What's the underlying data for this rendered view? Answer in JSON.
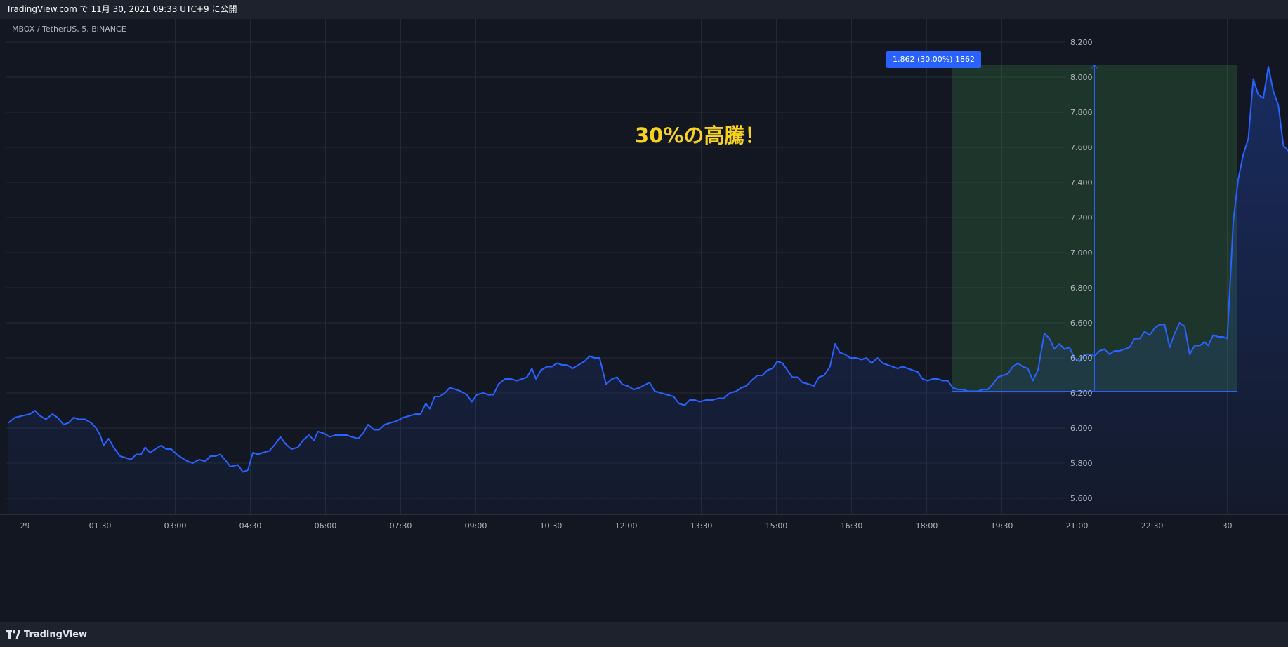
{
  "header": {
    "published_text": "TradingView.com で 11月 30, 2021 09:33 UTC+9 に公開"
  },
  "symbol": {
    "label": "MBOX / TetherUS, 5, BINANCE"
  },
  "annotation": {
    "text": "30%の高騰！"
  },
  "measure": {
    "label": "1.862 (30.00%) 1862"
  },
  "footer": {
    "logo_text": "TradingView"
  },
  "colors": {
    "background": "#131722",
    "line": "#2962ff",
    "area_fill": "#2962ff",
    "measure_fill": "#4caf50",
    "annotation": "#f7d21e",
    "grid": "#242832"
  },
  "chart_data": {
    "type": "area",
    "ylim": [
      5.5,
      8.3
    ],
    "y_ticks": [
      "8.200",
      "8.000",
      "7.800",
      "7.600",
      "7.400",
      "7.200",
      "7.000",
      "6.800",
      "6.600",
      "6.400",
      "6.200",
      "6.000",
      "5.800",
      "5.600"
    ],
    "x_ticks": [
      "29",
      "01:30",
      "03:00",
      "04:30",
      "06:00",
      "07:30",
      "09:00",
      "10:30",
      "12:00",
      "13:30",
      "15:00",
      "16:30",
      "18:00",
      "19:30",
      "21:00",
      "22:30",
      "30"
    ],
    "x_tick_hours": [
      0,
      1.5,
      3,
      4.5,
      6,
      7.5,
      9,
      10.5,
      12,
      13.5,
      15,
      16.5,
      18,
      19.5,
      21,
      22.5,
      24
    ],
    "series": [
      {
        "points": [
          [
            -0.33,
            6.03
          ],
          [
            -0.2,
            6.06
          ],
          [
            -0.05,
            6.07
          ],
          [
            0.1,
            6.08
          ],
          [
            0.2,
            6.1
          ],
          [
            0.3,
            6.07
          ],
          [
            0.42,
            6.05
          ],
          [
            0.55,
            6.08
          ],
          [
            0.65,
            6.06
          ],
          [
            0.77,
            6.02
          ],
          [
            0.87,
            6.03
          ],
          [
            0.97,
            6.06
          ],
          [
            1.08,
            6.05
          ],
          [
            1.2,
            6.05
          ],
          [
            1.32,
            6.03
          ],
          [
            1.42,
            6.0
          ],
          [
            1.5,
            5.96
          ],
          [
            1.57,
            5.9
          ],
          [
            1.67,
            5.94
          ],
          [
            1.77,
            5.89
          ],
          [
            1.9,
            5.84
          ],
          [
            2.02,
            5.83
          ],
          [
            2.12,
            5.82
          ],
          [
            2.22,
            5.85
          ],
          [
            2.32,
            5.85
          ],
          [
            2.4,
            5.89
          ],
          [
            2.5,
            5.86
          ],
          [
            2.6,
            5.88
          ],
          [
            2.72,
            5.9
          ],
          [
            2.82,
            5.88
          ],
          [
            2.92,
            5.88
          ],
          [
            3.03,
            5.85
          ],
          [
            3.13,
            5.83
          ],
          [
            3.25,
            5.81
          ],
          [
            3.35,
            5.8
          ],
          [
            3.48,
            5.82
          ],
          [
            3.6,
            5.81
          ],
          [
            3.7,
            5.84
          ],
          [
            3.8,
            5.84
          ],
          [
            3.9,
            5.85
          ],
          [
            4.02,
            5.81
          ],
          [
            4.1,
            5.78
          ],
          [
            4.25,
            5.79
          ],
          [
            4.35,
            5.75
          ],
          [
            4.45,
            5.76
          ],
          [
            4.55,
            5.86
          ],
          [
            4.65,
            5.85
          ],
          [
            4.75,
            5.86
          ],
          [
            4.88,
            5.87
          ],
          [
            5.0,
            5.91
          ],
          [
            5.1,
            5.95
          ],
          [
            5.2,
            5.91
          ],
          [
            5.32,
            5.88
          ],
          [
            5.45,
            5.89
          ],
          [
            5.55,
            5.93
          ],
          [
            5.67,
            5.96
          ],
          [
            5.77,
            5.93
          ],
          [
            5.85,
            5.98
          ],
          [
            5.97,
            5.97
          ],
          [
            6.08,
            5.95
          ],
          [
            6.2,
            5.96
          ],
          [
            6.3,
            5.96
          ],
          [
            6.42,
            5.96
          ],
          [
            6.52,
            5.95
          ],
          [
            6.65,
            5.94
          ],
          [
            6.75,
            5.97
          ],
          [
            6.85,
            6.02
          ],
          [
            6.97,
            5.99
          ],
          [
            7.07,
            5.99
          ],
          [
            7.18,
            6.02
          ],
          [
            7.3,
            6.03
          ],
          [
            7.42,
            6.04
          ],
          [
            7.55,
            6.06
          ],
          [
            7.68,
            6.07
          ],
          [
            7.8,
            6.08
          ],
          [
            7.9,
            6.08
          ],
          [
            8.0,
            6.14
          ],
          [
            8.08,
            6.11
          ],
          [
            8.18,
            6.18
          ],
          [
            8.28,
            6.18
          ],
          [
            8.38,
            6.2
          ],
          [
            8.48,
            6.23
          ],
          [
            8.6,
            6.22
          ],
          [
            8.7,
            6.21
          ],
          [
            8.82,
            6.19
          ],
          [
            8.92,
            6.15
          ],
          [
            9.02,
            6.19
          ],
          [
            9.15,
            6.2
          ],
          [
            9.25,
            6.19
          ],
          [
            9.35,
            6.19
          ],
          [
            9.45,
            6.25
          ],
          [
            9.58,
            6.28
          ],
          [
            9.7,
            6.28
          ],
          [
            9.82,
            6.27
          ],
          [
            9.92,
            6.28
          ],
          [
            10.02,
            6.29
          ],
          [
            10.12,
            6.34
          ],
          [
            10.2,
            6.28
          ],
          [
            10.3,
            6.33
          ],
          [
            10.42,
            6.35
          ],
          [
            10.52,
            6.35
          ],
          [
            10.62,
            6.37
          ],
          [
            10.72,
            6.36
          ],
          [
            10.82,
            6.36
          ],
          [
            10.93,
            6.34
          ],
          [
            11.05,
            6.36
          ],
          [
            11.17,
            6.38
          ],
          [
            11.27,
            6.41
          ],
          [
            11.37,
            6.4
          ],
          [
            11.47,
            6.4
          ],
          [
            11.6,
            6.25
          ],
          [
            11.72,
            6.28
          ],
          [
            11.82,
            6.29
          ],
          [
            11.92,
            6.25
          ],
          [
            12.03,
            6.24
          ],
          [
            12.15,
            6.22
          ],
          [
            12.27,
            6.23
          ],
          [
            12.4,
            6.25
          ],
          [
            12.47,
            6.26
          ],
          [
            12.57,
            6.21
          ],
          [
            12.7,
            6.2
          ],
          [
            12.82,
            6.19
          ],
          [
            12.95,
            6.18
          ],
          [
            13.05,
            6.14
          ],
          [
            13.17,
            6.13
          ],
          [
            13.27,
            6.16
          ],
          [
            13.37,
            6.16
          ],
          [
            13.47,
            6.15
          ],
          [
            13.6,
            6.16
          ],
          [
            13.72,
            6.16
          ],
          [
            13.85,
            6.17
          ],
          [
            13.95,
            6.17
          ],
          [
            14.07,
            6.2
          ],
          [
            14.2,
            6.21
          ],
          [
            14.3,
            6.23
          ],
          [
            14.4,
            6.24
          ],
          [
            14.5,
            6.27
          ],
          [
            14.62,
            6.3
          ],
          [
            14.72,
            6.3
          ],
          [
            14.82,
            6.33
          ],
          [
            14.92,
            6.34
          ],
          [
            15.02,
            6.38
          ],
          [
            15.12,
            6.37
          ],
          [
            15.22,
            6.33
          ],
          [
            15.32,
            6.29
          ],
          [
            15.42,
            6.29
          ],
          [
            15.52,
            6.26
          ],
          [
            15.65,
            6.25
          ],
          [
            15.75,
            6.24
          ],
          [
            15.85,
            6.29
          ],
          [
            15.95,
            6.3
          ],
          [
            16.07,
            6.35
          ],
          [
            16.17,
            6.48
          ],
          [
            16.27,
            6.43
          ],
          [
            16.37,
            6.42
          ],
          [
            16.47,
            6.4
          ],
          [
            16.6,
            6.4
          ],
          [
            16.7,
            6.39
          ],
          [
            16.8,
            6.4
          ],
          [
            16.9,
            6.37
          ],
          [
            17.02,
            6.4
          ],
          [
            17.12,
            6.37
          ],
          [
            17.22,
            6.36
          ],
          [
            17.32,
            6.35
          ],
          [
            17.42,
            6.34
          ],
          [
            17.52,
            6.35
          ],
          [
            17.62,
            6.34
          ],
          [
            17.72,
            6.33
          ],
          [
            17.82,
            6.32
          ],
          [
            17.92,
            6.28
          ],
          [
            18.02,
            6.27
          ],
          [
            18.12,
            6.28
          ],
          [
            18.22,
            6.28
          ],
          [
            18.32,
            6.27
          ],
          [
            18.42,
            6.27
          ],
          [
            18.52,
            6.23
          ],
          [
            18.62,
            6.22
          ],
          [
            18.72,
            6.22
          ],
          [
            18.82,
            6.21
          ],
          [
            18.92,
            6.21
          ],
          [
            19.02,
            6.21
          ],
          [
            19.12,
            6.22
          ],
          [
            19.22,
            6.22
          ],
          [
            19.32,
            6.25
          ],
          [
            19.42,
            6.29
          ],
          [
            19.52,
            6.3
          ],
          [
            19.62,
            6.31
          ],
          [
            19.72,
            6.35
          ],
          [
            19.82,
            6.37
          ],
          [
            19.92,
            6.35
          ],
          [
            20.02,
            6.34
          ],
          [
            20.12,
            6.27
          ],
          [
            20.22,
            6.33
          ],
          [
            20.35,
            6.54
          ],
          [
            20.45,
            6.51
          ],
          [
            20.55,
            6.45
          ],
          [
            20.65,
            6.48
          ],
          [
            20.75,
            6.45
          ],
          [
            20.85,
            6.46
          ],
          [
            20.95,
            6.4
          ],
          [
            21.05,
            6.38
          ],
          [
            21.15,
            6.42
          ],
          [
            21.25,
            6.42
          ],
          [
            21.35,
            6.41
          ],
          [
            21.45,
            6.44
          ],
          [
            21.55,
            6.45
          ],
          [
            21.65,
            6.42
          ],
          [
            21.75,
            6.44
          ],
          [
            21.85,
            6.44
          ],
          [
            21.95,
            6.45
          ],
          [
            22.05,
            6.46
          ],
          [
            22.15,
            6.51
          ],
          [
            22.25,
            6.51
          ],
          [
            22.35,
            6.55
          ],
          [
            22.45,
            6.53
          ],
          [
            22.55,
            6.57
          ],
          [
            22.65,
            6.59
          ],
          [
            22.75,
            6.59
          ],
          [
            22.85,
            6.46
          ],
          [
            22.95,
            6.54
          ],
          [
            23.05,
            6.6
          ],
          [
            23.15,
            6.58
          ],
          [
            23.25,
            6.42
          ],
          [
            23.35,
            6.47
          ],
          [
            23.45,
            6.47
          ],
          [
            23.55,
            6.49
          ],
          [
            23.62,
            6.47
          ],
          [
            23.72,
            6.53
          ],
          [
            23.82,
            6.52
          ],
          [
            23.92,
            6.52
          ],
          [
            24.0,
            6.51
          ],
          [
            24.12,
            7.18
          ],
          [
            24.22,
            7.42
          ],
          [
            24.32,
            7.56
          ],
          [
            24.42,
            7.65
          ],
          [
            24.52,
            7.99
          ],
          [
            24.62,
            7.9
          ],
          [
            24.72,
            7.88
          ],
          [
            24.82,
            8.06
          ],
          [
            24.92,
            7.92
          ],
          [
            25.02,
            7.84
          ],
          [
            25.12,
            7.61
          ],
          [
            25.22,
            7.58
          ],
          [
            25.32,
            7.59
          ],
          [
            25.42,
            7.66
          ],
          [
            25.52,
            7.69
          ],
          [
            25.62,
            7.78
          ],
          [
            25.72,
            7.96
          ],
          [
            25.82,
            7.82
          ],
          [
            25.92,
            7.93
          ],
          [
            26.02,
            7.88
          ],
          [
            26.12,
            7.89
          ],
          [
            26.22,
            7.86
          ],
          [
            26.32,
            7.67
          ],
          [
            26.42,
            7.75
          ],
          [
            26.52,
            7.88
          ],
          [
            26.62,
            7.79
          ],
          [
            26.72,
            7.81
          ],
          [
            26.82,
            7.62
          ],
          [
            26.92,
            7.69
          ],
          [
            27.02,
            7.69
          ],
          [
            27.12,
            7.72
          ],
          [
            27.22,
            7.6
          ],
          [
            27.32,
            7.52
          ],
          [
            27.42,
            7.57
          ],
          [
            27.52,
            7.6
          ],
          [
            27.62,
            7.56
          ],
          [
            27.72,
            7.48
          ],
          [
            27.82,
            7.55
          ],
          [
            27.92,
            7.44
          ],
          [
            28.02,
            7.5
          ],
          [
            28.12,
            7.68
          ],
          [
            28.22,
            7.83
          ],
          [
            28.32,
            7.93
          ],
          [
            28.42,
            7.8
          ],
          [
            28.52,
            7.83
          ],
          [
            28.62,
            7.68
          ],
          [
            28.72,
            7.63
          ],
          [
            28.82,
            7.63
          ],
          [
            28.92,
            7.75
          ],
          [
            29.02,
            7.68
          ],
          [
            29.12,
            7.51
          ],
          [
            29.2,
            7.55
          ]
        ]
      }
    ],
    "measure_range": {
      "x_start": 18.5,
      "x_end": 24.2,
      "y_low": 6.21,
      "y_high": 8.07
    },
    "grid": true
  }
}
